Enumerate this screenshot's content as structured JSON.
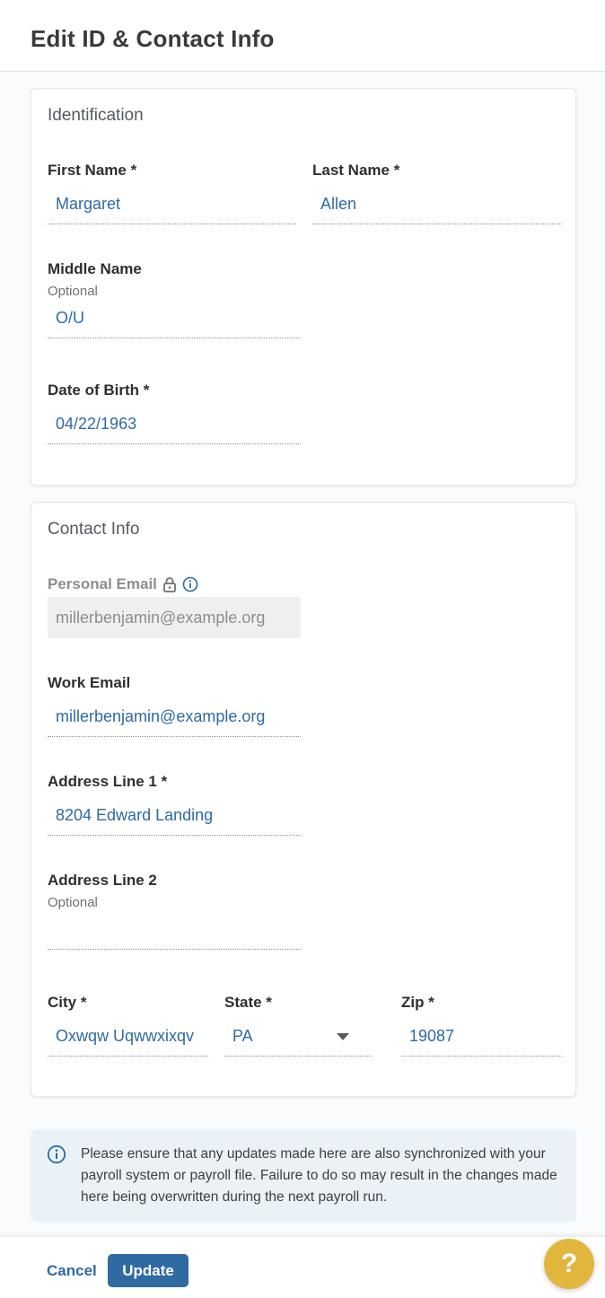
{
  "page": {
    "title": "Edit ID & Contact Info"
  },
  "identification": {
    "title": "Identification",
    "first_name": {
      "label": "First Name *",
      "value": "Margaret"
    },
    "last_name": {
      "label": "Last Name *",
      "value": "Allen"
    },
    "middle_name": {
      "label": "Middle Name",
      "hint": "Optional",
      "value": "O/U"
    },
    "dob": {
      "label": "Date of Birth *",
      "value": "04/22/1963"
    }
  },
  "contact": {
    "title": "Contact Info",
    "personal_email": {
      "label": "Personal Email",
      "value": "millerbenjamin@example.org",
      "locked": true
    },
    "work_email": {
      "label": "Work Email",
      "value": "millerbenjamin@example.org"
    },
    "address1": {
      "label": "Address Line 1 *",
      "value": "8204 Edward Landing"
    },
    "address2": {
      "label": "Address Line 2",
      "hint": "Optional",
      "value": ""
    },
    "city": {
      "label": "City *",
      "value": "Oxwqw Uqwwxixqv"
    },
    "state": {
      "label": "State *",
      "value": "PA"
    },
    "zip": {
      "label": "Zip *",
      "value": "19087"
    }
  },
  "notice": {
    "text": "Please ensure that any updates made here are also synchronized with your payroll system or payroll file. Failure to do so may result in the changes made here being overwritten during the next payroll run."
  },
  "footer": {
    "cancel_label": "Cancel",
    "update_label": "Update"
  },
  "help": {
    "label": "?"
  },
  "colors": {
    "accent": "#2f6aa3",
    "help": "#e2b63c",
    "notice_bg": "#eaf2f7"
  }
}
